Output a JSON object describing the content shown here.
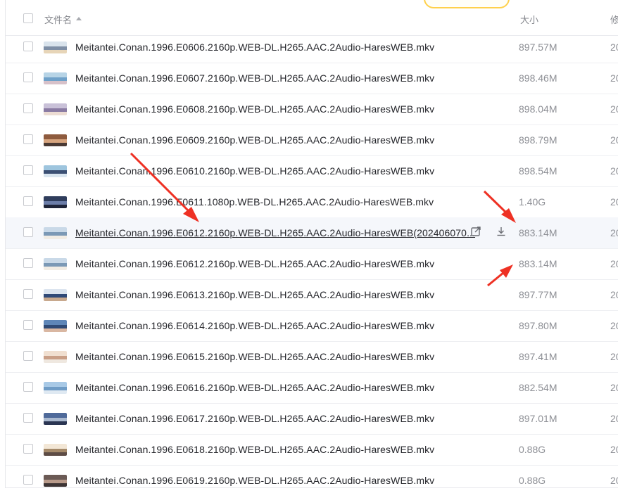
{
  "header": {
    "name_label": "文件名",
    "size_label": "大小",
    "modified_label": "修"
  },
  "files": [
    {
      "name": "Meitantei.Conan.1996.E0606.2160p.WEB-DL.H265.AAC.2Audio-HaresWEB.mkv",
      "size": "897.57M",
      "date": "20",
      "thumb": [
        "#d9e3ec",
        "#7f8fa6",
        "#e7d5b8"
      ]
    },
    {
      "name": "Meitantei.Conan.1996.E0607.2160p.WEB-DL.H265.AAC.2Audio-HaresWEB.mkv",
      "size": "898.46M",
      "date": "20",
      "thumb": [
        "#b7d4e6",
        "#6fa1c9",
        "#d7c1c9"
      ]
    },
    {
      "name": "Meitantei.Conan.1996.E0608.2160p.WEB-DL.H265.AAC.2Audio-HaresWEB.mkv",
      "size": "898.04M",
      "date": "20",
      "thumb": [
        "#c9c1d8",
        "#8a7ba3",
        "#ecdcd3"
      ]
    },
    {
      "name": "Meitantei.Conan.1996.E0609.2160p.WEB-DL.H265.AAC.2Audio-HaresWEB.mkv",
      "size": "898.79M",
      "date": "20",
      "thumb": [
        "#8e5b3e",
        "#d7a57f",
        "#4a3a34"
      ]
    },
    {
      "name": "Meitantei.Conan.1996.E0610.2160p.WEB-DL.H265.AAC.2Audio-HaresWEB.mkv",
      "size": "898.54M",
      "date": "20",
      "thumb": [
        "#9ec5de",
        "#3b4f73",
        "#d9e5ef"
      ]
    },
    {
      "name": "Meitantei.Conan.1996.E0611.1080p.WEB-DL.H265.AAC.2Audio-HaresWEB.mkv",
      "size": "1.40G",
      "date": "20",
      "thumb": [
        "#2f3d5c",
        "#6b7da8",
        "#1e2438"
      ]
    },
    {
      "name": "Meitantei.Conan.1996.E0612.2160p.WEB-DL.H265.AAC.2Audio-HaresWEB(202406070...",
      "size": "883.14M",
      "date": "20",
      "thumb": [
        "#c9d9e8",
        "#7b99b6",
        "#f1ece4"
      ],
      "hover": true
    },
    {
      "name": "Meitantei.Conan.1996.E0612.2160p.WEB-DL.H265.AAC.2Audio-HaresWEB.mkv",
      "size": "883.14M",
      "date": "20",
      "thumb": [
        "#c9d9e8",
        "#7b99b6",
        "#f1ece4"
      ]
    },
    {
      "name": "Meitantei.Conan.1996.E0613.2160p.WEB-DL.H265.AAC.2Audio-HaresWEB.mkv",
      "size": "897.77M",
      "date": "20",
      "thumb": [
        "#dbe4ef",
        "#304a78",
        "#c8a98e"
      ]
    },
    {
      "name": "Meitantei.Conan.1996.E0614.2160p.WEB-DL.H265.AAC.2Audio-HaresWEB.mkv",
      "size": "897.80M",
      "date": "20",
      "thumb": [
        "#5e86b8",
        "#2f4a76",
        "#d9b7a2"
      ]
    },
    {
      "name": "Meitantei.Conan.1996.E0615.2160p.WEB-DL.H265.AAC.2Audio-HaresWEB.mkv",
      "size": "897.41M",
      "date": "20",
      "thumb": [
        "#f0dfd0",
        "#c99f87",
        "#efe8e0"
      ]
    },
    {
      "name": "Meitantei.Conan.1996.E0616.2160p.WEB-DL.H265.AAC.2Audio-HaresWEB.mkv",
      "size": "882.54M",
      "date": "20",
      "thumb": [
        "#a8c9e6",
        "#6f9cc6",
        "#dfe9f2"
      ]
    },
    {
      "name": "Meitantei.Conan.1996.E0617.2160p.WEB-DL.H265.AAC.2Audio-HaresWEB.mkv",
      "size": "897.01M",
      "date": "20",
      "thumb": [
        "#4f6a9a",
        "#aab9cf",
        "#2a3552"
      ]
    },
    {
      "name": "Meitantei.Conan.1996.E0618.2160p.WEB-DL.H265.AAC.2Audio-HaresWEB.mkv",
      "size": "0.88G",
      "date": "20",
      "thumb": [
        "#f3e7d6",
        "#a58a6a",
        "#5d4c45"
      ]
    },
    {
      "name": "Meitantei.Conan.1996.E0619.2160p.WEB-DL.H265.AAC.2Audio-HaresWEB.mkv",
      "size": "0.88G",
      "date": "20",
      "thumb": [
        "#6b5a55",
        "#b89a8a",
        "#3d3434"
      ]
    }
  ],
  "colors": {
    "annotation_arrow": "#ee3124",
    "pill_border": "#ffd04a"
  },
  "icons": {
    "open": "external-open-icon",
    "download": "download-icon"
  }
}
